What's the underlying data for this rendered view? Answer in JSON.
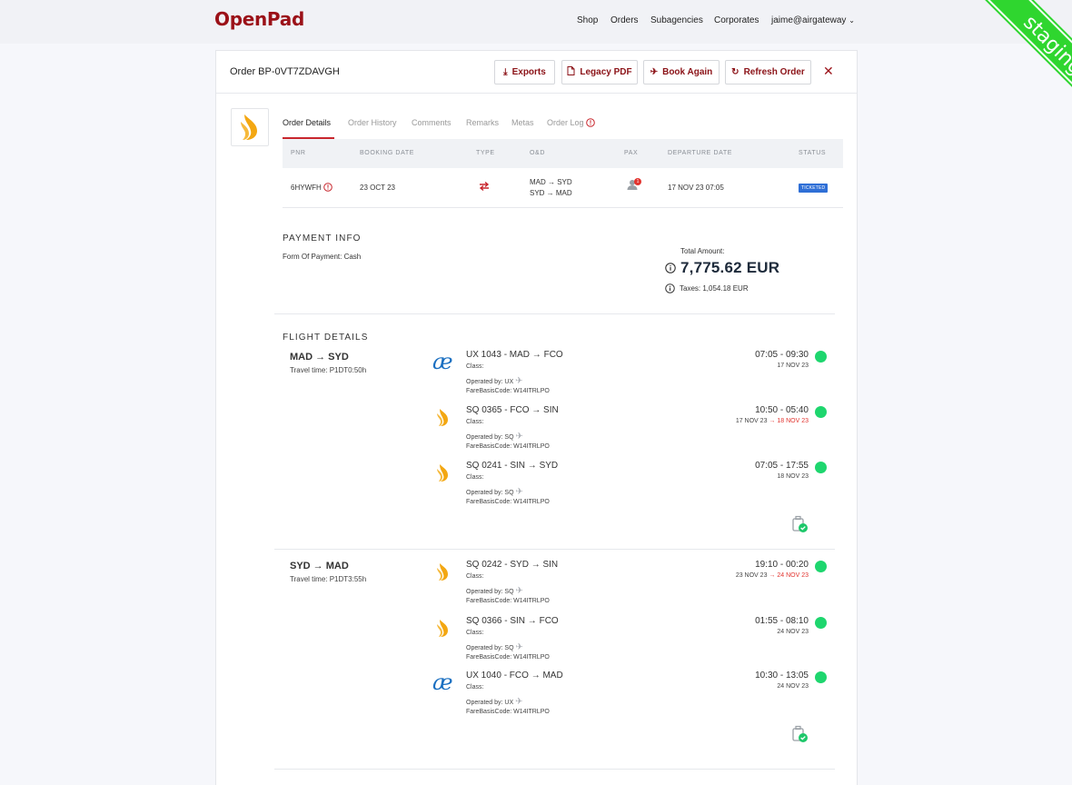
{
  "app": {
    "logo": "OpenPad"
  },
  "nav": {
    "items": [
      "Shop",
      "Orders",
      "Subagencies",
      "Corporates"
    ],
    "user": "jaime@airgateway"
  },
  "ribbon": {
    "label": "staging"
  },
  "order": {
    "title": "Order BP-0VT7ZDAVGH",
    "buttons": {
      "exports": "Exports",
      "legacy_pdf": "Legacy PDF",
      "book_again": "Book Again",
      "refresh": "Refresh Order"
    }
  },
  "tabs": [
    "Order Details",
    "Order History",
    "Comments",
    "Remarks",
    "Metas",
    "Order Log"
  ],
  "table": {
    "headers": [
      "PNR",
      "BOOKING DATE",
      "TYPE",
      "O&D",
      "PAX",
      "DEPARTURE DATE",
      "STATUS"
    ],
    "row": {
      "pnr": "6HYWFH",
      "booking_date": "23 OCT 23",
      "od_line1": "MAD → SYD",
      "od_line2": "SYD → MAD",
      "pax_count": "1",
      "departure_date": "17 NOV 23 07:05",
      "status": "TICKETED"
    }
  },
  "payment": {
    "title": "PAYMENT INFO",
    "form": "Form Of Payment: Cash",
    "total_label": "Total Amount:",
    "total": "7,775.62 EUR",
    "taxes": "Taxes: 1,054.18 EUR"
  },
  "flight_details": {
    "title": "FLIGHT DETAILS",
    "journeys": [
      {
        "route": "MAD → SYD",
        "travel_time": "Travel time: P1DT0:50h",
        "segments": [
          {
            "airline": "ux",
            "code": "UX 1043 - MAD → FCO",
            "class": "Class:",
            "operated": "Operated by: UX",
            "fare": "FareBasisCode: W14ITRLPO",
            "time": "07:05 - 09:30",
            "date": "17 NOV 23",
            "date_next": ""
          },
          {
            "airline": "sq",
            "code": "SQ 0365 - FCO → SIN",
            "class": "Class:",
            "operated": "Operated by: SQ",
            "fare": "FareBasisCode: W14ITRLPO",
            "time": "10:50 - 05:40",
            "date": "17 NOV 23",
            "date_next": "→ 18 NOV 23"
          },
          {
            "airline": "sq",
            "code": "SQ 0241 - SIN → SYD",
            "class": "Class:",
            "operated": "Operated by: SQ",
            "fare": "FareBasisCode: W14ITRLPO",
            "time": "07:05 - 17:55",
            "date": "18 NOV 23",
            "date_next": ""
          }
        ]
      },
      {
        "route": "SYD → MAD",
        "travel_time": "Travel time: P1DT3:55h",
        "segments": [
          {
            "airline": "sq",
            "code": "SQ 0242 - SYD → SIN",
            "class": "Class:",
            "operated": "Operated by: SQ",
            "fare": "FareBasisCode: W14ITRLPO",
            "time": "19:10 - 00:20",
            "date": "23 NOV 23",
            "date_next": "→ 24 NOV 23"
          },
          {
            "airline": "sq",
            "code": "SQ 0366 - SIN → FCO",
            "class": "Class:",
            "operated": "Operated by: SQ",
            "fare": "FareBasisCode: W14ITRLPO",
            "time": "01:55 - 08:10",
            "date": "24 NOV 23",
            "date_next": ""
          },
          {
            "airline": "ux",
            "code": "UX 1040 - FCO → MAD",
            "class": "Class:",
            "operated": "Operated by: UX",
            "fare": "FareBasisCode: W14ITRLPO",
            "time": "10:30 - 13:05",
            "date": "24 NOV 23",
            "date_next": ""
          }
        ]
      }
    ]
  },
  "colors": {
    "brand": "#9b1118",
    "ticketed": "#2f6fd6",
    "ok": "#1ed66e",
    "staging": "#2fd62f"
  }
}
